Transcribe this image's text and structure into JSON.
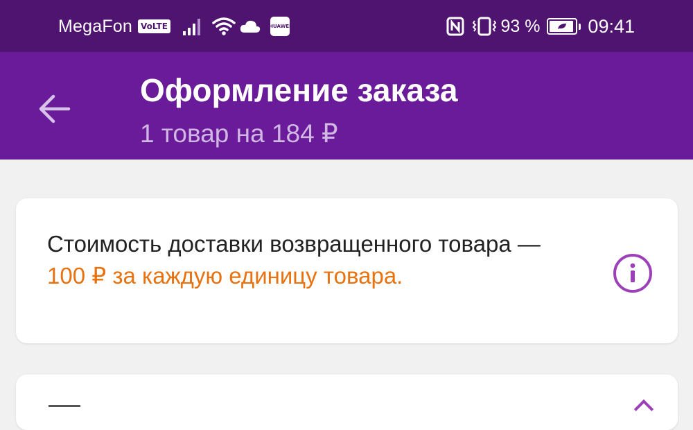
{
  "status_bar": {
    "carrier": "MegaFon",
    "volte_badge": "VoLTE",
    "huawei_badge": "HUAWEI",
    "battery_percent": "93 %",
    "battery_level": 0.93,
    "time": "09:41",
    "icons": [
      "signal-icon",
      "wifi-icon",
      "cloud-icon",
      "nfc-icon",
      "vibrate-icon",
      "battery-icon"
    ]
  },
  "app_bar": {
    "back_icon": "arrow-left-icon",
    "title": "Оформление заказа",
    "subtitle": "1 товар на 184 ₽"
  },
  "notice_card": {
    "line_1": "Стоимость доставки возвращенного товара —",
    "line_2": "100 ₽ за каждую единицу товара.",
    "info_icon": "info-icon"
  },
  "colors": {
    "status_bar_bg": "#4f1470",
    "app_bar_bg": "#6a1b9a",
    "accent_orange": "#e8720f",
    "info_icon_purple": "#9c3fb8"
  }
}
